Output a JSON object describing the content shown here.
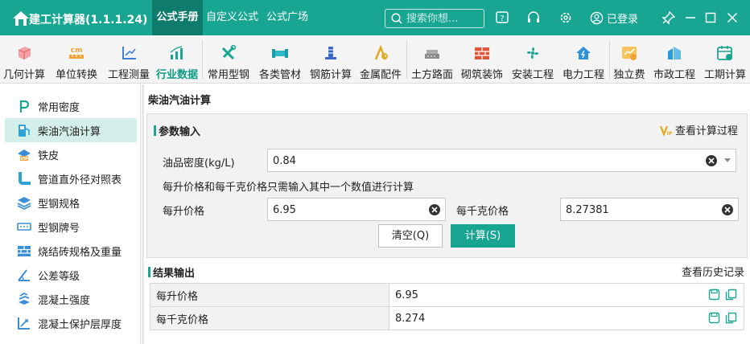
{
  "app": {
    "title": "建工计算器(1.1.1.24)",
    "accent": "#18a592",
    "accent_dark": "#0e7b6c"
  },
  "top_tabs": [
    {
      "label": "公式手册",
      "active": true
    },
    {
      "label": "自定义公式",
      "active": false
    },
    {
      "label": "公式广场",
      "active": false
    }
  ],
  "search": {
    "placeholder": "搜索你想..."
  },
  "header_icons": [
    "help-icon",
    "headset-icon",
    "settings-icon",
    "user-icon",
    "pin-icon",
    "minimize-icon",
    "maximize-icon",
    "close-icon"
  ],
  "user": {
    "login_label": "已登录"
  },
  "toolbar": {
    "items": [
      {
        "label": "几何计算",
        "icon": "cube-icon",
        "color": "#e8767b"
      },
      {
        "label": "单位转换",
        "icon": "cm-ruler-icon",
        "color": "#f0a238"
      },
      {
        "label": "工程测量",
        "icon": "axis-icon",
        "color": "#3d7fd9"
      },
      {
        "label": "行业数据",
        "icon": "bar-chart-icon",
        "color": "#18a592",
        "active": true
      },
      {
        "label": "常用型钢",
        "icon": "wrench-icon",
        "color": "#18a592"
      },
      {
        "label": "各类管材",
        "icon": "pipe-icon",
        "color": "#2fb8c8"
      },
      {
        "label": "钢筋计算",
        "icon": "rebar-icon",
        "color": "#3a66c6"
      },
      {
        "label": "金属配件",
        "icon": "crane-icon",
        "color": "#e0a81e"
      },
      {
        "label": "土方路面",
        "icon": "road-icon",
        "color": "#8a8a8a"
      },
      {
        "label": "砌筑装饰",
        "icon": "brick-icon",
        "color": "#e0553a"
      },
      {
        "label": "安装工程",
        "icon": "fan-icon",
        "color": "#18a592"
      },
      {
        "label": "电力工程",
        "icon": "house-power-icon",
        "color": "#2f8fd8"
      },
      {
        "label": "独立费",
        "icon": "chart-money-icon",
        "color": "#f0a238"
      },
      {
        "label": "市政工程",
        "icon": "building-icon",
        "color": "#2a9bd6"
      },
      {
        "label": "工期计算",
        "icon": "calendar-icon",
        "color": "#18a592"
      }
    ]
  },
  "sidebar": {
    "items": [
      {
        "label": "常用密度",
        "icon": "density-icon"
      },
      {
        "label": "柴油汽油计算",
        "icon": "fuel-pump-icon",
        "active": true
      },
      {
        "label": "铁皮",
        "icon": "vip-sheet-icon"
      },
      {
        "label": "管道直外径对照表",
        "icon": "pipe-elbow-icon"
      },
      {
        "label": "型钢规格",
        "icon": "layers-icon"
      },
      {
        "label": "型钢牌号",
        "icon": "tag-icon"
      },
      {
        "label": "烧结砖规格及重量",
        "icon": "bricks-icon"
      },
      {
        "label": "公差等级",
        "icon": "angle-icon"
      },
      {
        "label": "混凝土强度",
        "icon": "stack-icon"
      },
      {
        "label": "混凝土保护层厚度",
        "icon": "protect-icon"
      }
    ]
  },
  "main": {
    "title": "柴油汽油计算",
    "params": {
      "section_title": "参数输入",
      "view_process": "查看计算过程",
      "density_label": "油品密度(kg/L)",
      "density_value": "0.84",
      "hint": "每升价格和每千克价格只需输入其中一个数值进行计算",
      "per_liter_label": "每升价格",
      "per_liter_value": "6.95",
      "per_kg_label": "每千克价格",
      "per_kg_value": "8.27381",
      "clear_button": "清空(Q)",
      "calc_button": "计算(S)"
    },
    "results": {
      "section_title": "结果输出",
      "history": "查看历史记录",
      "rows": [
        {
          "name": "每升价格",
          "value": "6.95"
        },
        {
          "name": "每千克价格",
          "value": "8.274"
        }
      ]
    }
  }
}
